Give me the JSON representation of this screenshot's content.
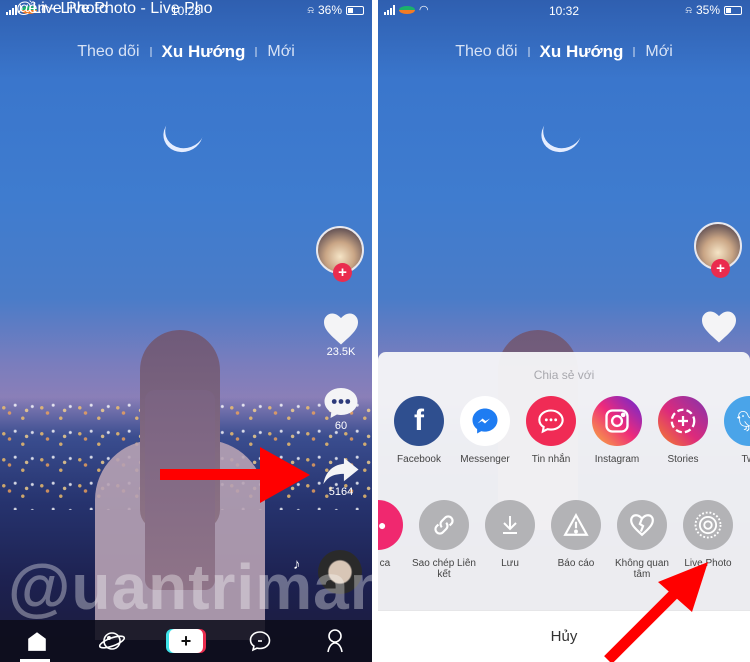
{
  "left_screen": {
    "status": {
      "time": "10:28",
      "battery": "36%",
      "battery_level": 0.36
    },
    "top_tabs": [
      {
        "label": "Theo dõi",
        "active": false
      },
      {
        "label": "Xu Hướng",
        "active": true
      },
      {
        "label": "Mới",
        "active": false
      }
    ],
    "side_actions": {
      "likes": "23.5K",
      "comments": "60",
      "shares": "5164"
    },
    "caption": {
      "username": "@Live Photo",
      "music": "ền - Live Photo - Live Pho"
    },
    "bottom_nav": [
      {
        "icon": "home-icon",
        "label": "Home"
      },
      {
        "icon": "discover-icon",
        "label": "Discover"
      },
      {
        "icon": "create-icon",
        "label": "+"
      },
      {
        "icon": "inbox-icon",
        "label": "Inbox"
      },
      {
        "icon": "profile-icon",
        "label": "Me"
      }
    ]
  },
  "right_screen": {
    "status": {
      "time": "10:32",
      "battery": "35%",
      "battery_level": 0.35
    },
    "top_tabs": [
      {
        "label": "Theo dõi",
        "active": false
      },
      {
        "label": "Xu Hướng",
        "active": true
      },
      {
        "label": "Mới",
        "active": false
      }
    ],
    "share_sheet": {
      "title": "Chia sẻ với",
      "share_targets": [
        {
          "label": "Facebook",
          "icon": "facebook-icon",
          "color": "#3b5998"
        },
        {
          "label": "Messenger",
          "icon": "messenger-icon",
          "color": "#ffffff"
        },
        {
          "label": "Tin nhắn",
          "icon": "message-icon",
          "color": "#f02b55"
        },
        {
          "label": "Instagram",
          "icon": "instagram-icon",
          "color": "#c13584"
        },
        {
          "label": "Stories",
          "icon": "stories-icon",
          "color": "#a13ab2"
        },
        {
          "label": "Twi",
          "icon": "twitter-icon",
          "color": "#4aa4e9"
        }
      ],
      "actions": [
        {
          "label": "ng ca",
          "icon": "duet-icon"
        },
        {
          "label": "Sao chép Liên kết",
          "icon": "link-icon"
        },
        {
          "label": "Lưu",
          "icon": "download-icon"
        },
        {
          "label": "Báo cáo",
          "icon": "report-icon"
        },
        {
          "label": "Không quan tâm",
          "icon": "broken-heart-icon"
        },
        {
          "label": "Live Photo",
          "icon": "live-photo-icon"
        }
      ],
      "cancel_label": "Hủy"
    }
  },
  "watermark": "@uantrimang",
  "colors": {
    "accent_red": "#ea2c4e",
    "arrow_red": "#ff0000",
    "sky_blue": "#3f7ccf"
  }
}
